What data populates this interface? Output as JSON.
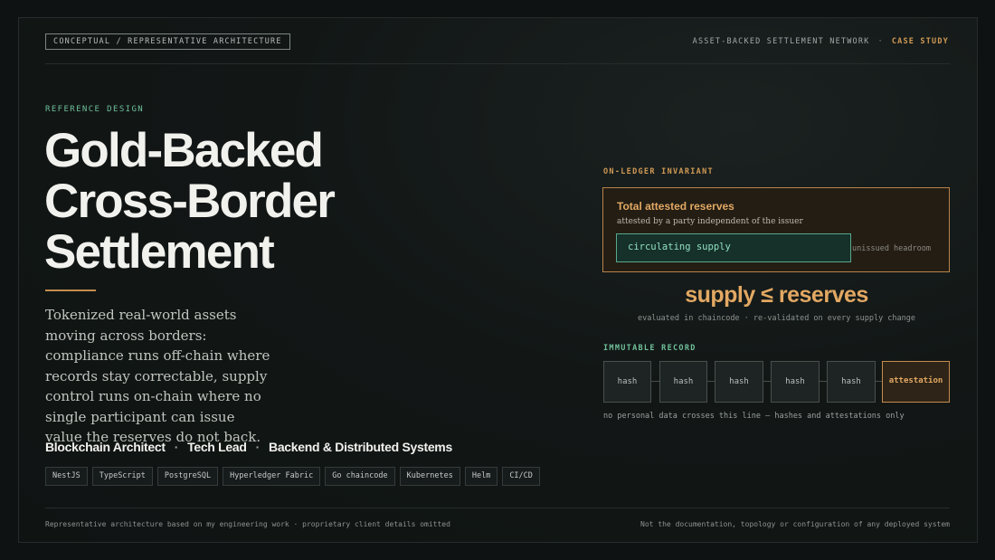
{
  "header": {
    "badge": "CONCEPTUAL / REPRESENTATIVE ARCHITECTURE",
    "network": "ASSET-BACKED SETTLEMENT NETWORK",
    "separator": "·",
    "case_label": "CASE STUDY"
  },
  "hero": {
    "eyebrow": "REFERENCE DESIGN",
    "title_lines": [
      "Gold-Backed",
      "Cross-Border",
      "Settlement"
    ],
    "lede": "Tokenized real-world assets moving across borders: compliance runs off-chain where records stay correctable, supply control runs on-chain where no single participant can issue value the reserves do not back.",
    "roles": [
      "Blockchain Architect",
      "Tech Lead",
      "Backend & Distributed Systems"
    ],
    "role_separator": "·",
    "tags": [
      "NestJS",
      "TypeScript",
      "PostgreSQL",
      "Hyperledger Fabric",
      "Go chaincode",
      "Kubernetes",
      "Helm",
      "CI/CD"
    ]
  },
  "invariant": {
    "label": "ON-LEDGER INVARIANT",
    "box_title": "Total attested reserves",
    "box_subtitle": "attested by a party independent of the issuer",
    "supply_label": "circulating supply",
    "headroom_label": "unissued headroom",
    "formula": "supply ≤ reserves",
    "formula_note": "evaluated in chaincode · re-validated on every supply change"
  },
  "record": {
    "label": "IMMUTABLE RECORD",
    "blocks": [
      "hash",
      "hash",
      "hash",
      "hash",
      "hash",
      "attestation"
    ],
    "note": "no personal data crosses this line — hashes and attestations only"
  },
  "footer": {
    "left": "Representative architecture based on my engineering work · proprietary client details omitted",
    "right": "Not the documentation, topology or configuration of any deployed system"
  },
  "colors": {
    "background": "#0e1212",
    "accent_gold": "#d19a55",
    "accent_green": "#6fbf9a",
    "text_primary": "#f1f1ed"
  }
}
